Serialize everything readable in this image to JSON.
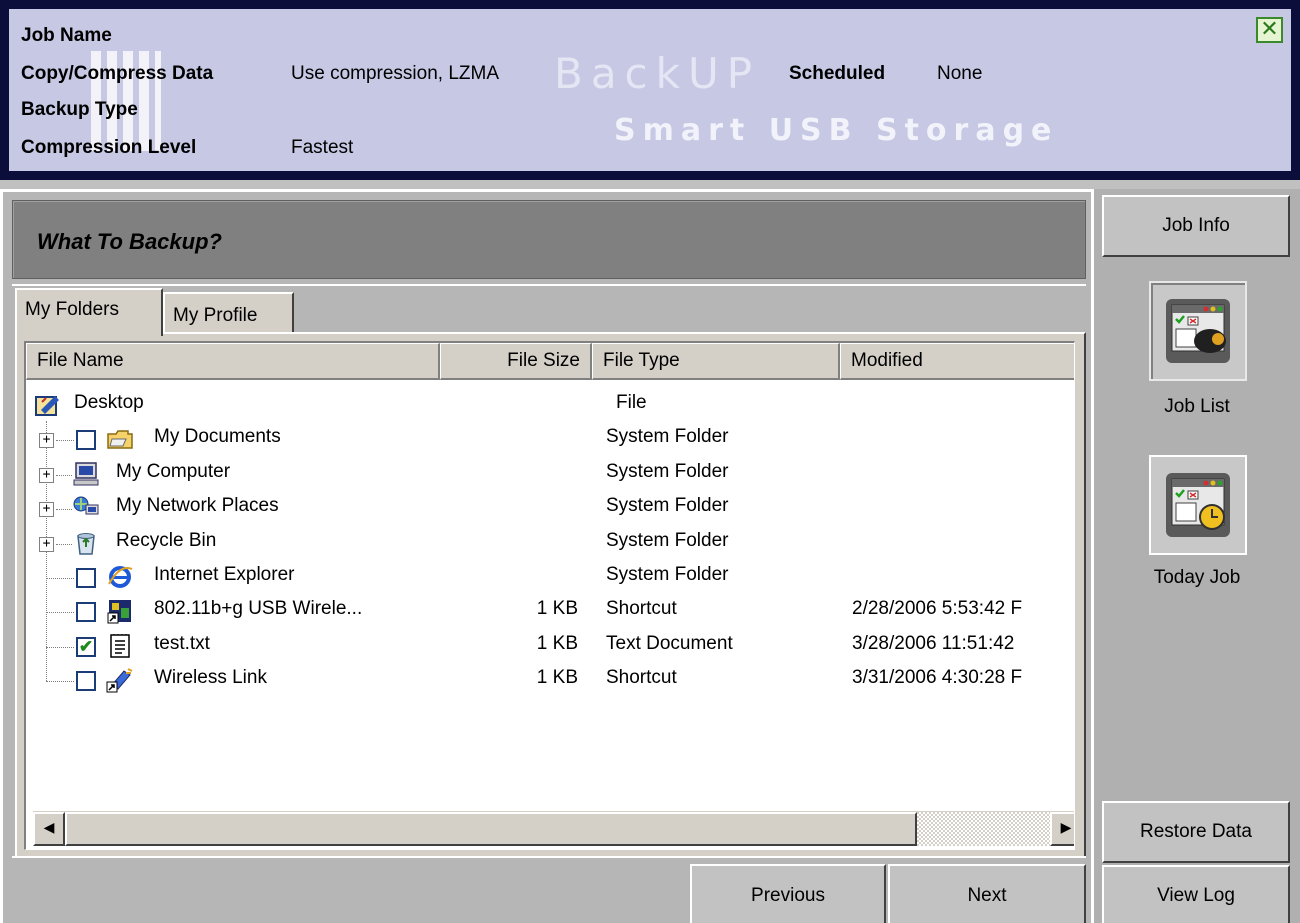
{
  "header": {
    "job_name_label": "Job Name",
    "job_name_value": "",
    "copy_compress_label": "Copy/Compress Data",
    "copy_compress_value": "Use compression, LZMA",
    "scheduled_label": "Scheduled",
    "scheduled_value": "None",
    "backup_type_label": "Backup Type",
    "backup_type_value": "",
    "compression_level_label": "Compression Level",
    "compression_level_value": "Fastest",
    "watermark_backup": "BackUP",
    "watermark_smart": "Smart USB Storage",
    "close_icon": "close-icon"
  },
  "main": {
    "title": "What To Backup?",
    "tabs": [
      {
        "label": "My Folders",
        "active": true
      },
      {
        "label": "My Profile",
        "active": false
      }
    ],
    "columns": {
      "name": "File Name",
      "size": "File Size",
      "type": "File Type",
      "modified": "Modified"
    },
    "rows": [
      {
        "name": "Desktop",
        "size": "",
        "type": "File",
        "modified": "",
        "icon": "desktop-icon",
        "expander": false,
        "checkbox": false,
        "checked": false
      },
      {
        "name": "My Documents",
        "size": "",
        "type": "System Folder",
        "modified": "",
        "icon": "folder-icon",
        "expander": true,
        "checkbox": true,
        "checked": false
      },
      {
        "name": "My Computer",
        "size": "",
        "type": "System Folder",
        "modified": "",
        "icon": "computer-icon",
        "expander": true,
        "checkbox": false,
        "checked": false
      },
      {
        "name": "My Network Places",
        "size": "",
        "type": "System Folder",
        "modified": "",
        "icon": "network-icon",
        "expander": true,
        "checkbox": false,
        "checked": false
      },
      {
        "name": "Recycle Bin",
        "size": "",
        "type": "System Folder",
        "modified": "",
        "icon": "recycle-bin-icon",
        "expander": true,
        "checkbox": false,
        "checked": false
      },
      {
        "name": "Internet Explorer",
        "size": "",
        "type": "System Folder",
        "modified": "",
        "icon": "ie-icon",
        "expander": false,
        "checkbox": true,
        "checked": false
      },
      {
        "name": "802.11b+g USB Wirele...",
        "size": "1 KB",
        "type": "Shortcut",
        "modified": "2/28/2006 5:53:42 F",
        "icon": "shortcut-icon",
        "expander": false,
        "checkbox": true,
        "checked": false
      },
      {
        "name": "test.txt",
        "size": "1 KB",
        "type": "Text Document",
        "modified": "3/28/2006 11:51:42",
        "icon": "text-file-icon",
        "expander": false,
        "checkbox": true,
        "checked": true
      },
      {
        "name": "Wireless Link",
        "size": "1 KB",
        "type": "Shortcut",
        "modified": "3/31/2006 4:30:28 F",
        "icon": "wireless-icon",
        "expander": false,
        "checkbox": true,
        "checked": false
      }
    ],
    "prev_label": "Previous",
    "next_label": "Next"
  },
  "sidebar": {
    "job_info_label": "Job Info",
    "job_list_label": "Job List",
    "today_job_label": "Today Job",
    "restore_label": "Restore Data",
    "view_log_label": "View Log"
  },
  "colors": {
    "header_frame": "#0b0d3a",
    "header_bg": "#c6c8e4",
    "panel_bg": "#b6b6b6",
    "check_green": "#1e8a1e"
  }
}
